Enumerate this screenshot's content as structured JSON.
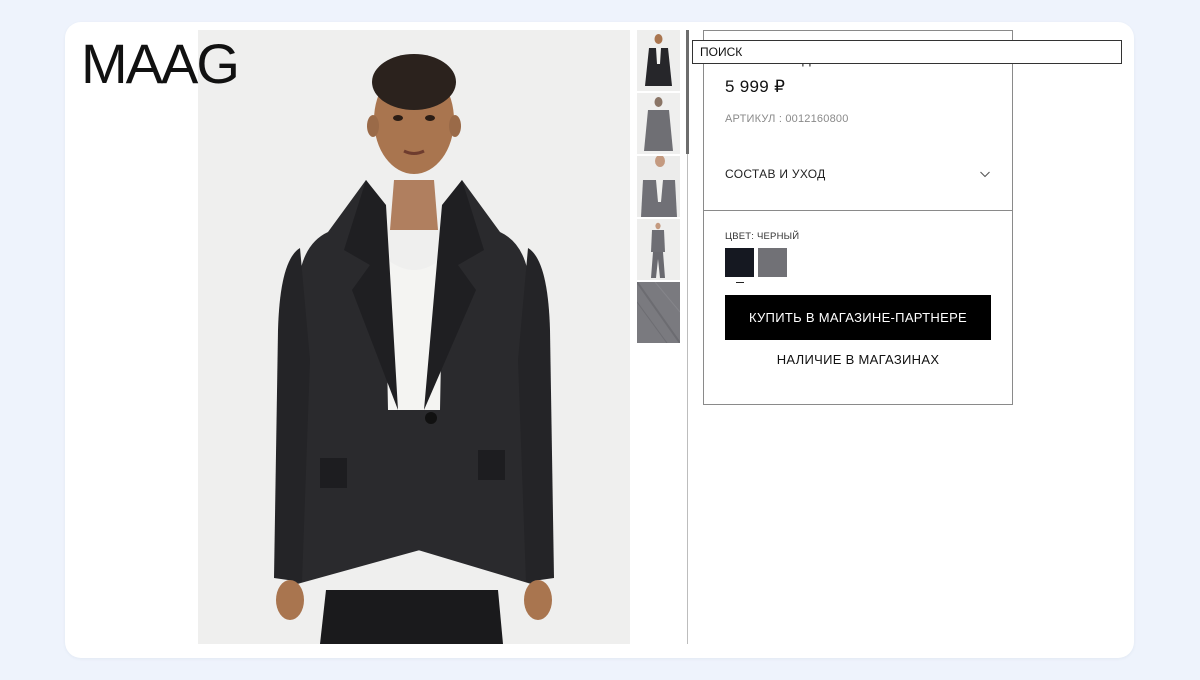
{
  "brand": {
    "logo_text": "MAAG"
  },
  "search": {
    "label": "ПОИСК"
  },
  "gallery": {
    "thumbnails": [
      "thumb-front-full",
      "thumb-back",
      "thumb-crop-detail",
      "thumb-full-length",
      "thumb-fabric-closeup"
    ]
  },
  "product": {
    "title": "БАЗОВЫЙ ОДНОБОРТНЫЙ БЛЕЙЗЕР",
    "price": "5 999 ₽",
    "sku": "АРТИКУЛ : 0012160800",
    "care_label": "СОСТАВ И УХОД",
    "color_label": "ЦВЕТ: ЧЕРНЫЙ",
    "swatches": [
      {
        "name": "black",
        "hex": "#151821"
      },
      {
        "name": "grey",
        "hex": "#717176"
      }
    ],
    "buy_button": "КУПИТЬ В МАГАЗИНЕ-ПАРТНЕРЕ",
    "stores_link": "НАЛИЧИЕ В МАГАЗИНАХ"
  },
  "colors": {
    "page_bg": "#eef3fc",
    "card_bg": "#ffffff",
    "button_bg": "#000000"
  },
  "icons": {
    "care_toggle": "chevron-down-icon"
  }
}
